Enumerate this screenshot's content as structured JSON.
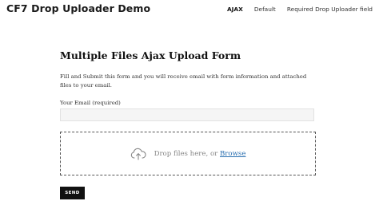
{
  "header": {
    "site_title": "CF7 Drop Uploader Demo",
    "nav": [
      {
        "label": "AJAX",
        "active": true
      },
      {
        "label": "Default",
        "active": false
      },
      {
        "label": "Required Drop Uploader field",
        "active": false
      }
    ]
  },
  "form": {
    "title": "Multiple Files Ajax Upload Form",
    "description": "Fill and Submit this form and you will receive email with form information and attached files to your email.",
    "email_label": "Your Email (required)",
    "email_value": "",
    "dropzone": {
      "icon": "cloud-upload-icon",
      "text": "Drop files here, or",
      "browse_label": "Browse"
    },
    "send_label": "SEND"
  },
  "colors": {
    "background": "#ffffff",
    "text": "#222222",
    "link": "#2a6fb0",
    "button_bg": "#111111",
    "input_bg": "#f5f5f5"
  }
}
